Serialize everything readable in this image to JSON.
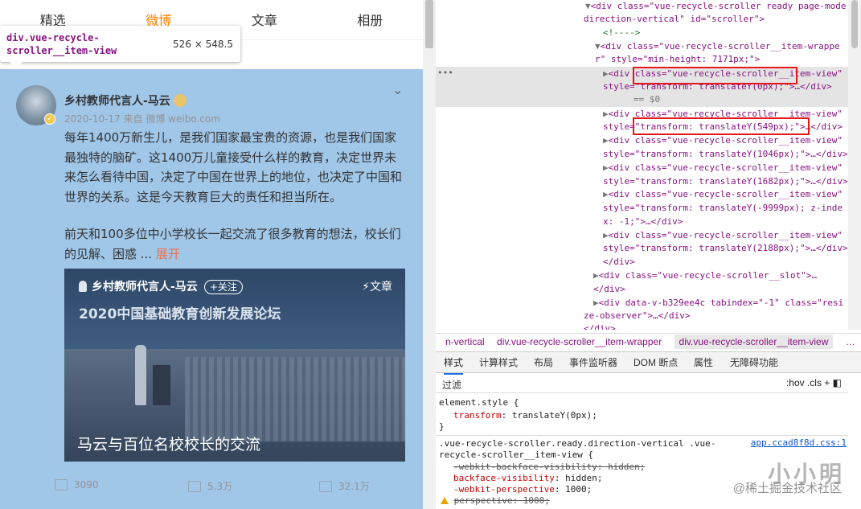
{
  "weibo": {
    "tabs": [
      "精选",
      "微博",
      "文章",
      "相册"
    ],
    "active_tab": "微博",
    "tooltip": {
      "selector": "div.vue-recycle-scroller__item-view",
      "size": "526 × 548.5"
    },
    "post": {
      "author": "乡村教师代言人-马云",
      "meta": "2020-10-17  来自 微博 weibo.com",
      "text1": "每年1400万新生儿，是我们国家最宝贵的资源，也是我们国家最独特的脑矿。这1400万儿童接受什么样的教育，决定世界未来怎么看待中国，决定了中国在世界上的地位，也决定了中国和世界的关系。这是今天教育巨大的责任和担当所在。",
      "text2": "前天和100多位中小学校长一起交流了很多教育的想法，校长们的见解、困惑 ...",
      "expand": "展开",
      "card": {
        "author": "乡村教师代言人-马云",
        "follow": "+关注",
        "type": "文章",
        "banner": "2020中国基础教育创新发展论坛",
        "caption": "马云与百位名校校长的交流"
      },
      "actions": {
        "repost": "3090",
        "comment": "5.3万",
        "like": "32.1万"
      }
    }
  },
  "devtools": {
    "dom_lines": [
      "<div class=\"vue-recycle-scroller ready page-mode",
      "direction-vertical\" id=\"scroller\">",
      "<!---->",
      "<div class=\"vue-recycle-scroller__item-wrappe",
      "r\" style=\"min-height: 7171px;\">",
      "<div class=\"vue-recycle-scroller__item-view\"",
      "style=\"transform: translateY(0px);\">…</div>",
      "== $0",
      "<div class=\"vue-recycle-scroller__item-view\"",
      "style=\"transform: translateY(549px);\">…</div>",
      "<div class=\"vue-recycle-scroller__item-view\"",
      "style=\"transform: translateY(1046px);\">…</div>",
      "<div class=\"vue-recycle-scroller__item-view\"",
      "style=\"transform: translateY(1682px);\">…</div>",
      "<div class=\"vue-recycle-scroller__item-view\"",
      "style=\"transform: translateY(-9999px); z-inde",
      "x: -1;\">…</div>",
      "<div class=\"vue-recycle-scroller__item-view\"",
      "style=\"transform: translateY(2188px);\">…</div>",
      "</div>",
      "<div class=\"vue-recycle-scroller__slot\">…",
      "</div>",
      "<div data-v-b329ee4c tabindex=\"-1\" class=\"resi",
      "ze-observer\">…</div>",
      "</div>"
    ],
    "breadcrumbs": [
      "n-vertical",
      "div.vue-recycle-scroller__item-wrapper",
      "div.vue-recycle-scroller__item-view",
      "…"
    ],
    "subtabs": [
      "样式",
      "计算样式",
      "布局",
      "事件监听器",
      "DOM 断点",
      "属性",
      "无障碍功能"
    ],
    "active_subtab": "样式",
    "filter_placeholder": "过滤",
    "filter_tools": ":hov  .cls  +",
    "styles": {
      "element_style_selector": "element.style {",
      "element_style_prop": "transform",
      "element_style_val": "translateY(0px);",
      "close_brace": "}",
      "rule_selector_1": ".vue-recycle-scroller.ready.direction-vertical .vue-",
      "rule_selector_2": "recycle-scroller__item-view {",
      "rule_source": "app.ccad8f8d.css:1",
      "rule_props": [
        {
          "prop": "-webkit-backface-visibility",
          "val": "hidden;",
          "struck": true
        },
        {
          "prop": "backface-visibility",
          "val": "hidden;",
          "struck": false
        },
        {
          "prop": "-webkit-perspective",
          "val": "1000;",
          "struck": false
        },
        {
          "prop": "perspective",
          "val": "1000;",
          "struck": true
        }
      ]
    },
    "watermark": "小小明",
    "watermark_sub": "@稀土掘金技术社区"
  },
  "colors": {
    "weibo_accent": "#ff8200",
    "highlight": "#6fa8dc",
    "redbox": "#e41818",
    "tag": "#881280"
  }
}
